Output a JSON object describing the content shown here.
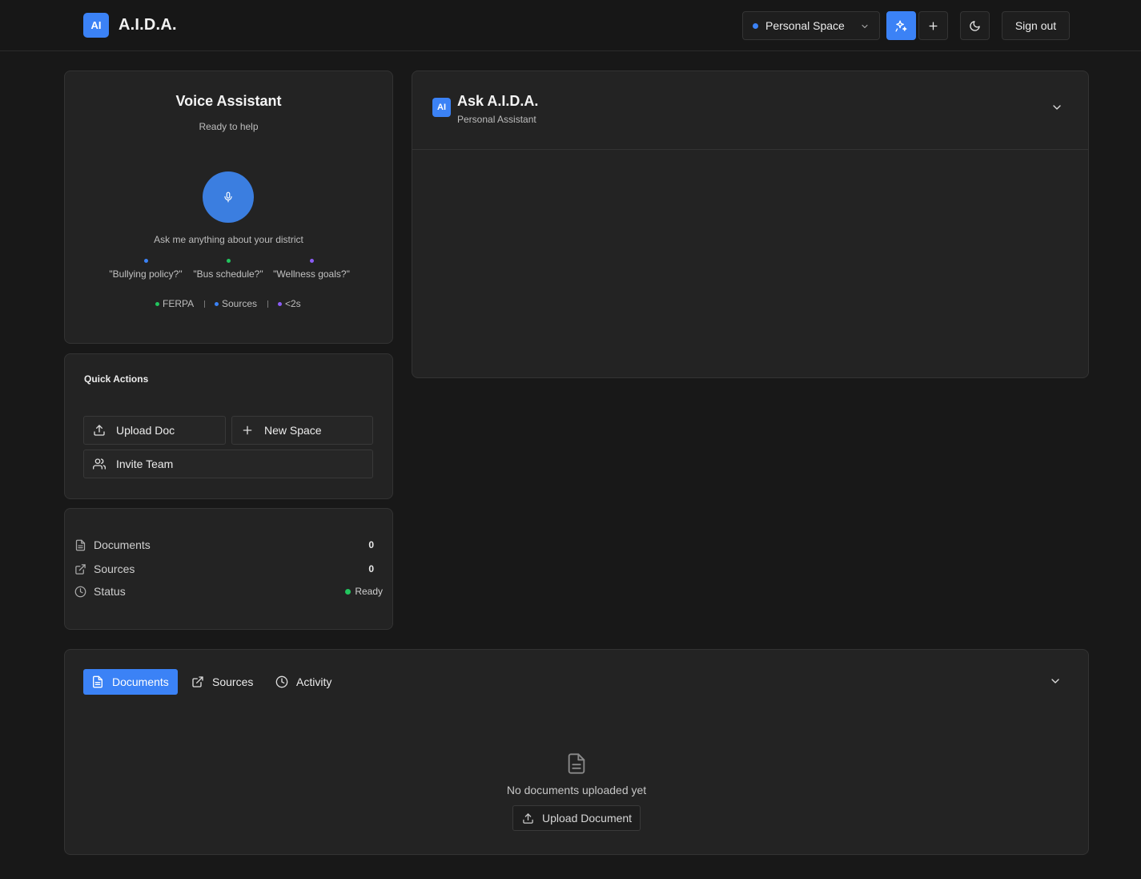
{
  "header": {
    "logo_badge": "AI",
    "app_title": "A.I.D.A.",
    "space_selector": {
      "label": "Personal Space",
      "dot_color": "#3b82f6",
      "icon": "chevron-down-icon"
    },
    "ai_button_icon": "sparkles-icon",
    "add_button_icon": "plus-icon",
    "theme_button_icon": "moon-icon",
    "sign_out_label": "Sign out"
  },
  "voice_assistant": {
    "title": "Voice Assistant",
    "subtitle": "Ready to help",
    "mic_icon": "microphone-icon",
    "hint": "Ask me anything about your district",
    "suggestions": [
      {
        "text": "\"Bullying policy?\"",
        "color": "#3b82f6"
      },
      {
        "text": "\"Bus schedule?\"",
        "color": "#22c55e"
      },
      {
        "text": "\"Wellness goals?\"",
        "color": "#8b5cf6"
      }
    ],
    "features": [
      {
        "text": "FERPA",
        "color": "#22c55e"
      },
      {
        "text": "Sources",
        "color": "#3b82f6"
      },
      {
        "text": "<2s",
        "color": "#8b5cf6"
      }
    ]
  },
  "quick_actions": {
    "title": "Quick Actions",
    "buttons": [
      {
        "label": "Upload Doc",
        "icon": "upload-icon"
      },
      {
        "label": "New Space",
        "icon": "plus-icon"
      },
      {
        "label": "Invite Team",
        "icon": "users-icon"
      }
    ]
  },
  "stats": {
    "rows": [
      {
        "label": "Documents",
        "value": "0",
        "icon": "file-text-icon"
      },
      {
        "label": "Sources",
        "value": "0",
        "icon": "external-link-icon"
      },
      {
        "label": "Status",
        "value": "Ready",
        "icon": "clock-icon",
        "status_color": "#22c55e"
      }
    ]
  },
  "ask_panel": {
    "badge": "AI",
    "title": "Ask A.I.D.A.",
    "subtitle": "Personal Assistant",
    "toggle_icon": "chevron-down-icon"
  },
  "documents_panel": {
    "tabs": [
      {
        "label": "Documents",
        "icon": "file-text-icon",
        "active": true
      },
      {
        "label": "Sources",
        "icon": "external-link-icon",
        "active": false
      },
      {
        "label": "Activity",
        "icon": "clock-icon",
        "active": false
      }
    ],
    "toggle_icon": "chevron-down-icon",
    "empty_icon": "file-text-icon",
    "empty_text": "No documents uploaded yet",
    "upload_button_label": "Upload Document"
  },
  "colors": {
    "accent": "#3b82f6",
    "success": "#22c55e",
    "purple": "#8b5cf6",
    "background": "#181818",
    "card": "#232323"
  }
}
